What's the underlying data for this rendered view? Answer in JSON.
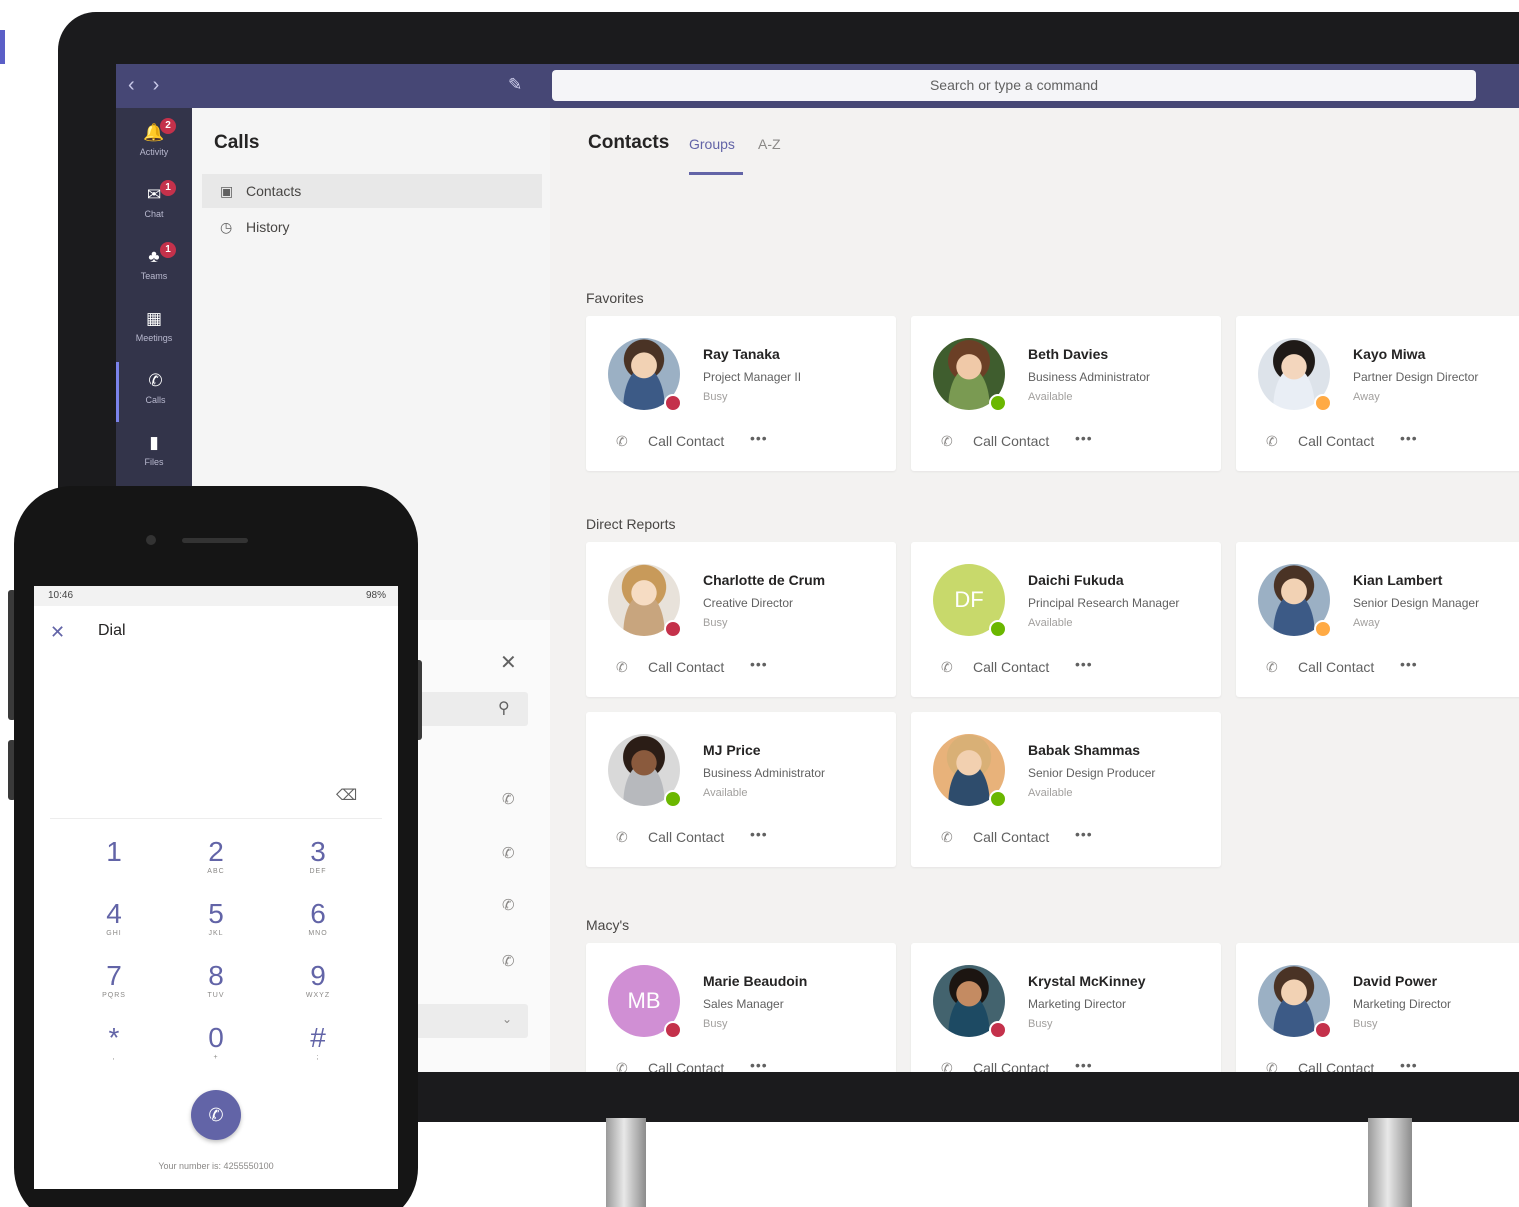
{
  "window": {
    "search_placeholder": "Search or type a command",
    "nav_back": "‹",
    "nav_forward": "›",
    "compose_icon": "compose-icon"
  },
  "rail": [
    {
      "label": "Activity",
      "icon": "bell-icon",
      "badge": "2"
    },
    {
      "label": "Chat",
      "icon": "chat-icon",
      "badge": "1"
    },
    {
      "label": "Teams",
      "icon": "teams-icon",
      "badge": "1"
    },
    {
      "label": "Meetings",
      "icon": "calendar-icon",
      "badge": ""
    },
    {
      "label": "Calls",
      "icon": "phone-icon",
      "badge": ""
    },
    {
      "label": "Files",
      "icon": "file-icon",
      "badge": ""
    }
  ],
  "calls_panel": {
    "title": "Calls",
    "items": [
      {
        "label": "Contacts",
        "icon": "contacts-icon"
      },
      {
        "label": "History",
        "icon": "history-icon"
      }
    ]
  },
  "main": {
    "title": "Contacts",
    "tabs": [
      "Groups",
      "A-Z"
    ],
    "active_tab": "Groups",
    "call_label": "Call Contact",
    "more_label": "•••",
    "sections": [
      {
        "label": "Favorites",
        "contacts": [
          {
            "name": "Ray Tanaka",
            "title": "Project Manager II",
            "status": "Busy"
          },
          {
            "name": "Beth Davies",
            "title": "Business Administrator",
            "status": "Available"
          },
          {
            "name": "Kayo Miwa",
            "title": "Partner Design Director",
            "status": "Away"
          }
        ]
      },
      {
        "label": "Direct Reports",
        "contacts": [
          {
            "name": "Charlotte de Crum",
            "title": "Creative Director",
            "status": "Busy"
          },
          {
            "name": "Daichi Fukuda",
            "title": "Principal Research Manager",
            "status": "Available",
            "initials": "DF"
          },
          {
            "name": "Kian Lambert",
            "title": "Senior Design Manager",
            "status": "Away"
          },
          {
            "name": "MJ Price",
            "title": "Business Administrator",
            "status": "Available"
          },
          {
            "name": "Babak Shammas",
            "title": "Senior Design Producer",
            "status": "Available"
          }
        ]
      },
      {
        "label": "Macy's",
        "contacts": [
          {
            "name": "Marie Beaudoin",
            "title": "Sales Manager",
            "status": "Busy",
            "initials": "MB"
          },
          {
            "name": "Krystal McKinney",
            "title": "Marketing Director",
            "status": "Busy"
          },
          {
            "name": "David Power",
            "title": "Marketing Director",
            "status": "Busy"
          }
        ]
      }
    ]
  },
  "phone": {
    "time": "10:46",
    "battery": "98%",
    "title": "Dial",
    "keys": [
      {
        "n": "1",
        "l": ""
      },
      {
        "n": "2",
        "l": "ABC"
      },
      {
        "n": "3",
        "l": "DEF"
      },
      {
        "n": "4",
        "l": "GHI"
      },
      {
        "n": "5",
        "l": "JKL"
      },
      {
        "n": "6",
        "l": "MNO"
      },
      {
        "n": "7",
        "l": "PQRS"
      },
      {
        "n": "8",
        "l": "TUV"
      },
      {
        "n": "9",
        "l": "WXYZ"
      },
      {
        "n": "*",
        "l": ","
      },
      {
        "n": "0",
        "l": "+"
      },
      {
        "n": "#",
        "l": ";"
      }
    ],
    "your_number": "Your number is: 4255550100"
  },
  "colors": {
    "accent": "#6264a7",
    "titlebar": "#464775",
    "rail": "#33344a",
    "busy": "#c4314b",
    "available": "#6bb700",
    "away": "#ffaa44",
    "initials_df": "#c8d96b",
    "initials_mb": "#d08fd4"
  }
}
